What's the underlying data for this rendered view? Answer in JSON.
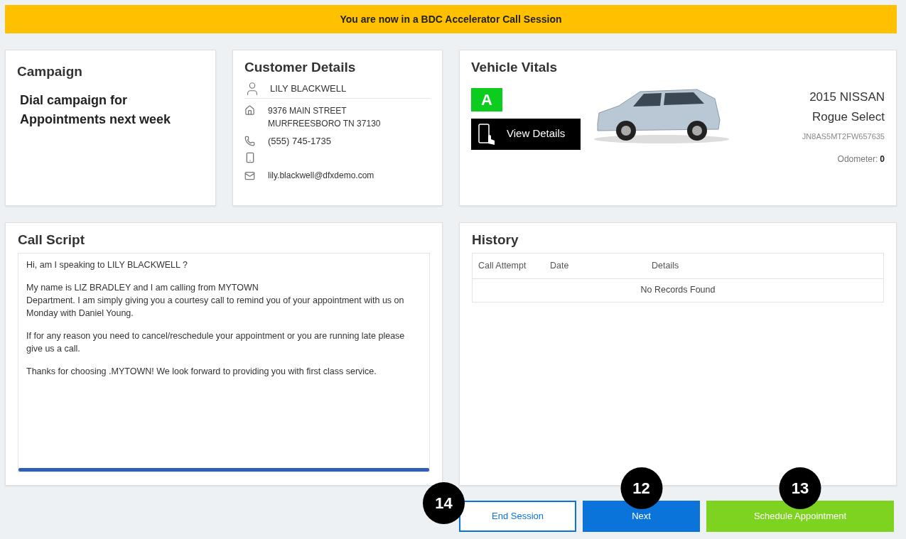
{
  "banner": "You are now in a BDC Accelerator Call Session",
  "campaign": {
    "title": "Campaign",
    "name": "Dial campaign for Appointments next week"
  },
  "customer": {
    "title": "Customer Details",
    "name": "LILY BLACKWELL",
    "address": [
      "9376 MAIN STREET",
      "MURFREESBORO TN 37130"
    ],
    "phone": "(555) 745-1735",
    "email": "lily.blackwell@dfxdemo.com"
  },
  "vehicle": {
    "title": "Vehicle Vitals",
    "grade": "A",
    "view_details": "View Details",
    "year_make": "2015 NISSAN",
    "model": "Rogue Select",
    "vin": "JN8AS5MT2FW657635",
    "odometer_label": "Odometer:",
    "odometer": "0"
  },
  "call_script": {
    "title": "Call Script",
    "paragraphs": [
      [
        "Hi, am I speaking to  LILY BLACKWELL ?"
      ],
      [
        "My name is LIZ BRADLEY and I am calling from MYTOWN",
        "Department.  I am simply giving you a courtesy call to remind you of your appointment with us on Monday with Daniel Young."
      ],
      [
        "If for any reason you need to cancel/reschedule your appointment or you are running late please give us a call."
      ],
      [
        "Thanks for choosing .MYTOWN!  We look forward to providing you with first class service."
      ]
    ]
  },
  "history": {
    "title": "History",
    "columns": [
      "Call Attempt",
      "Date",
      "Details"
    ],
    "empty": "No Records Found"
  },
  "buttons": [
    {
      "kind": "outline",
      "label": "End Session",
      "callout": "14"
    },
    {
      "kind": "primary",
      "label": "Next",
      "callout": "12"
    },
    {
      "kind": "success",
      "label": "Schedule Appointment",
      "callout": "13"
    }
  ]
}
